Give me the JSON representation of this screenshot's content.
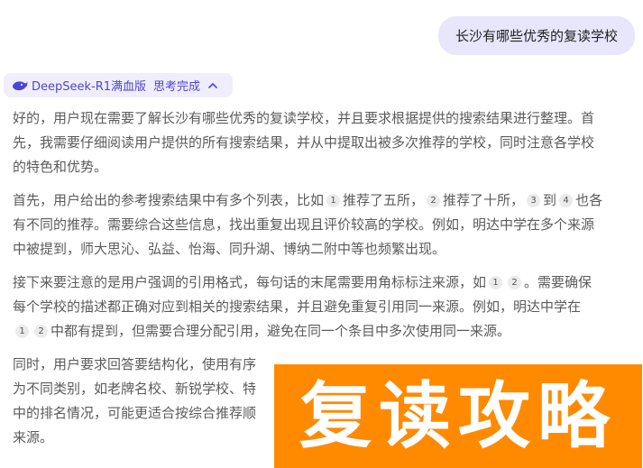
{
  "user_message": "长沙有哪些优秀的复读学校",
  "model": {
    "name": "DeepSeek-R1满血版",
    "status": "思考完成",
    "icon": "whale-icon",
    "accent": "#4d45d6"
  },
  "thinking": {
    "p1": {
      "l1": "好的，用户现在需要了解长沙有哪些优秀的复读学校，并且要求根据提供的搜索结果进行整理。首",
      "l2": "先，我需要仔细阅读用户提供的所有搜索结果，并从中提取出被多次推荐的学校，同时注意各学校",
      "l3": "的特色和优势。"
    },
    "p2": {
      "l1a": "首先，用户给出的参考搜索结果中有多个列表，比如",
      "c1": "1",
      "l1b": "推荐了五所，",
      "c2": "2",
      "l1c": "推荐了十所，",
      "c3": "3",
      "l1d": "到",
      "c4": "4",
      "l1e": "也各",
      "l2": "有不同的推荐。需要综合这些信息，找出重复出现且评价较高的学校。例如，明达中学在多个来源",
      "l3": "中被提到，师大思沁、弘益、怡海、同升湖、博纳二附中等也频繁出现。"
    },
    "p3": {
      "l1a": "接下来要注意的是用户强调的引用格式，每句话的末尾需要用角标标注来源，如",
      "c1": "1",
      "c2": "2",
      "l1b": "。需要确保",
      "l2": "每个学校的描述都正确对应到相关的搜索结果，并且避免重复引用同一来源。例如，明达中学在",
      "c3": "1",
      "c4": "2",
      "l3": "中都有提到，但需要合理分配引用，避免在同一个条目中多次使用同一来源。"
    },
    "p4": {
      "l1": "同时，用户要求回答要结构化，使用有序",
      "l2": "为不同类别，如老牌名校、新锐学校、特",
      "l3": "中的排名情况，可能更适合按综合推荐顺",
      "l4": "来源。"
    }
  },
  "banner": {
    "text": "复读攻略",
    "color": "#ff8a00"
  }
}
